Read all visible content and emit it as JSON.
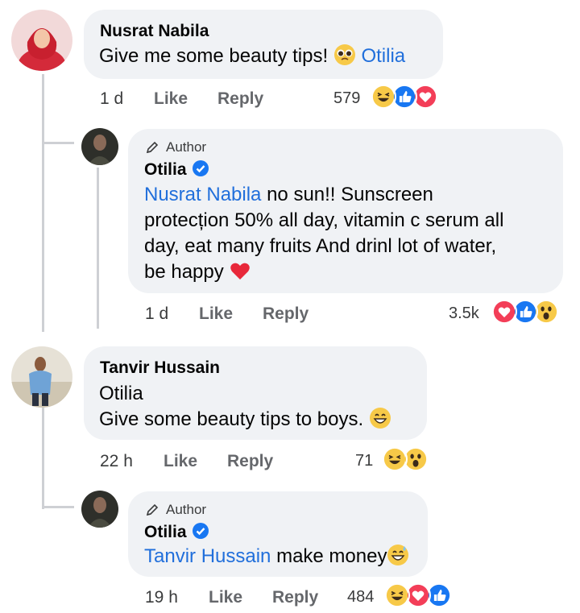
{
  "comments": [
    {
      "author": "Nusrat Nabila",
      "text": "Give me some beauty tips!",
      "mention": "Otilia",
      "time": "1 d",
      "like_label": "Like",
      "reply_label": "Reply",
      "reaction_count": "579",
      "reactions": [
        "haha",
        "like",
        "love"
      ],
      "reply": {
        "badge": "Author",
        "author": "Otilia",
        "mention": "Nusrat Nabila",
        "lines": [
          " no sun!! Sunscreen",
          "protecțion 50% all day, vitamin c serum all",
          "day, eat many fruits And drinl lot of water,",
          "be happy"
        ],
        "time": "1 d",
        "like_label": "Like",
        "reply_label": "Reply",
        "reaction_count": "3.5k",
        "reactions": [
          "love",
          "like",
          "wow"
        ]
      }
    },
    {
      "author": "Tanvir Hussain",
      "lines": [
        "Otilia",
        " Give some beauty tips to boys."
      ],
      "time": "22 h",
      "like_label": "Like",
      "reply_label": "Reply",
      "reaction_count": "71",
      "reactions": [
        "haha",
        "wow"
      ],
      "reply": {
        "badge": "Author",
        "author": "Otilia",
        "mention": "Tanvir Hussain",
        "text": " make money",
        "time": "19 h",
        "like_label": "Like",
        "reply_label": "Reply",
        "reaction_count": "484",
        "reactions": [
          "haha",
          "love",
          "like"
        ]
      }
    }
  ],
  "colors": {
    "bubble": "#f0f2f5",
    "mention": "#216fdb",
    "like_blue": "#1877f2",
    "love_red": "#f33e58",
    "emoji_yellow": "#f7c948"
  }
}
